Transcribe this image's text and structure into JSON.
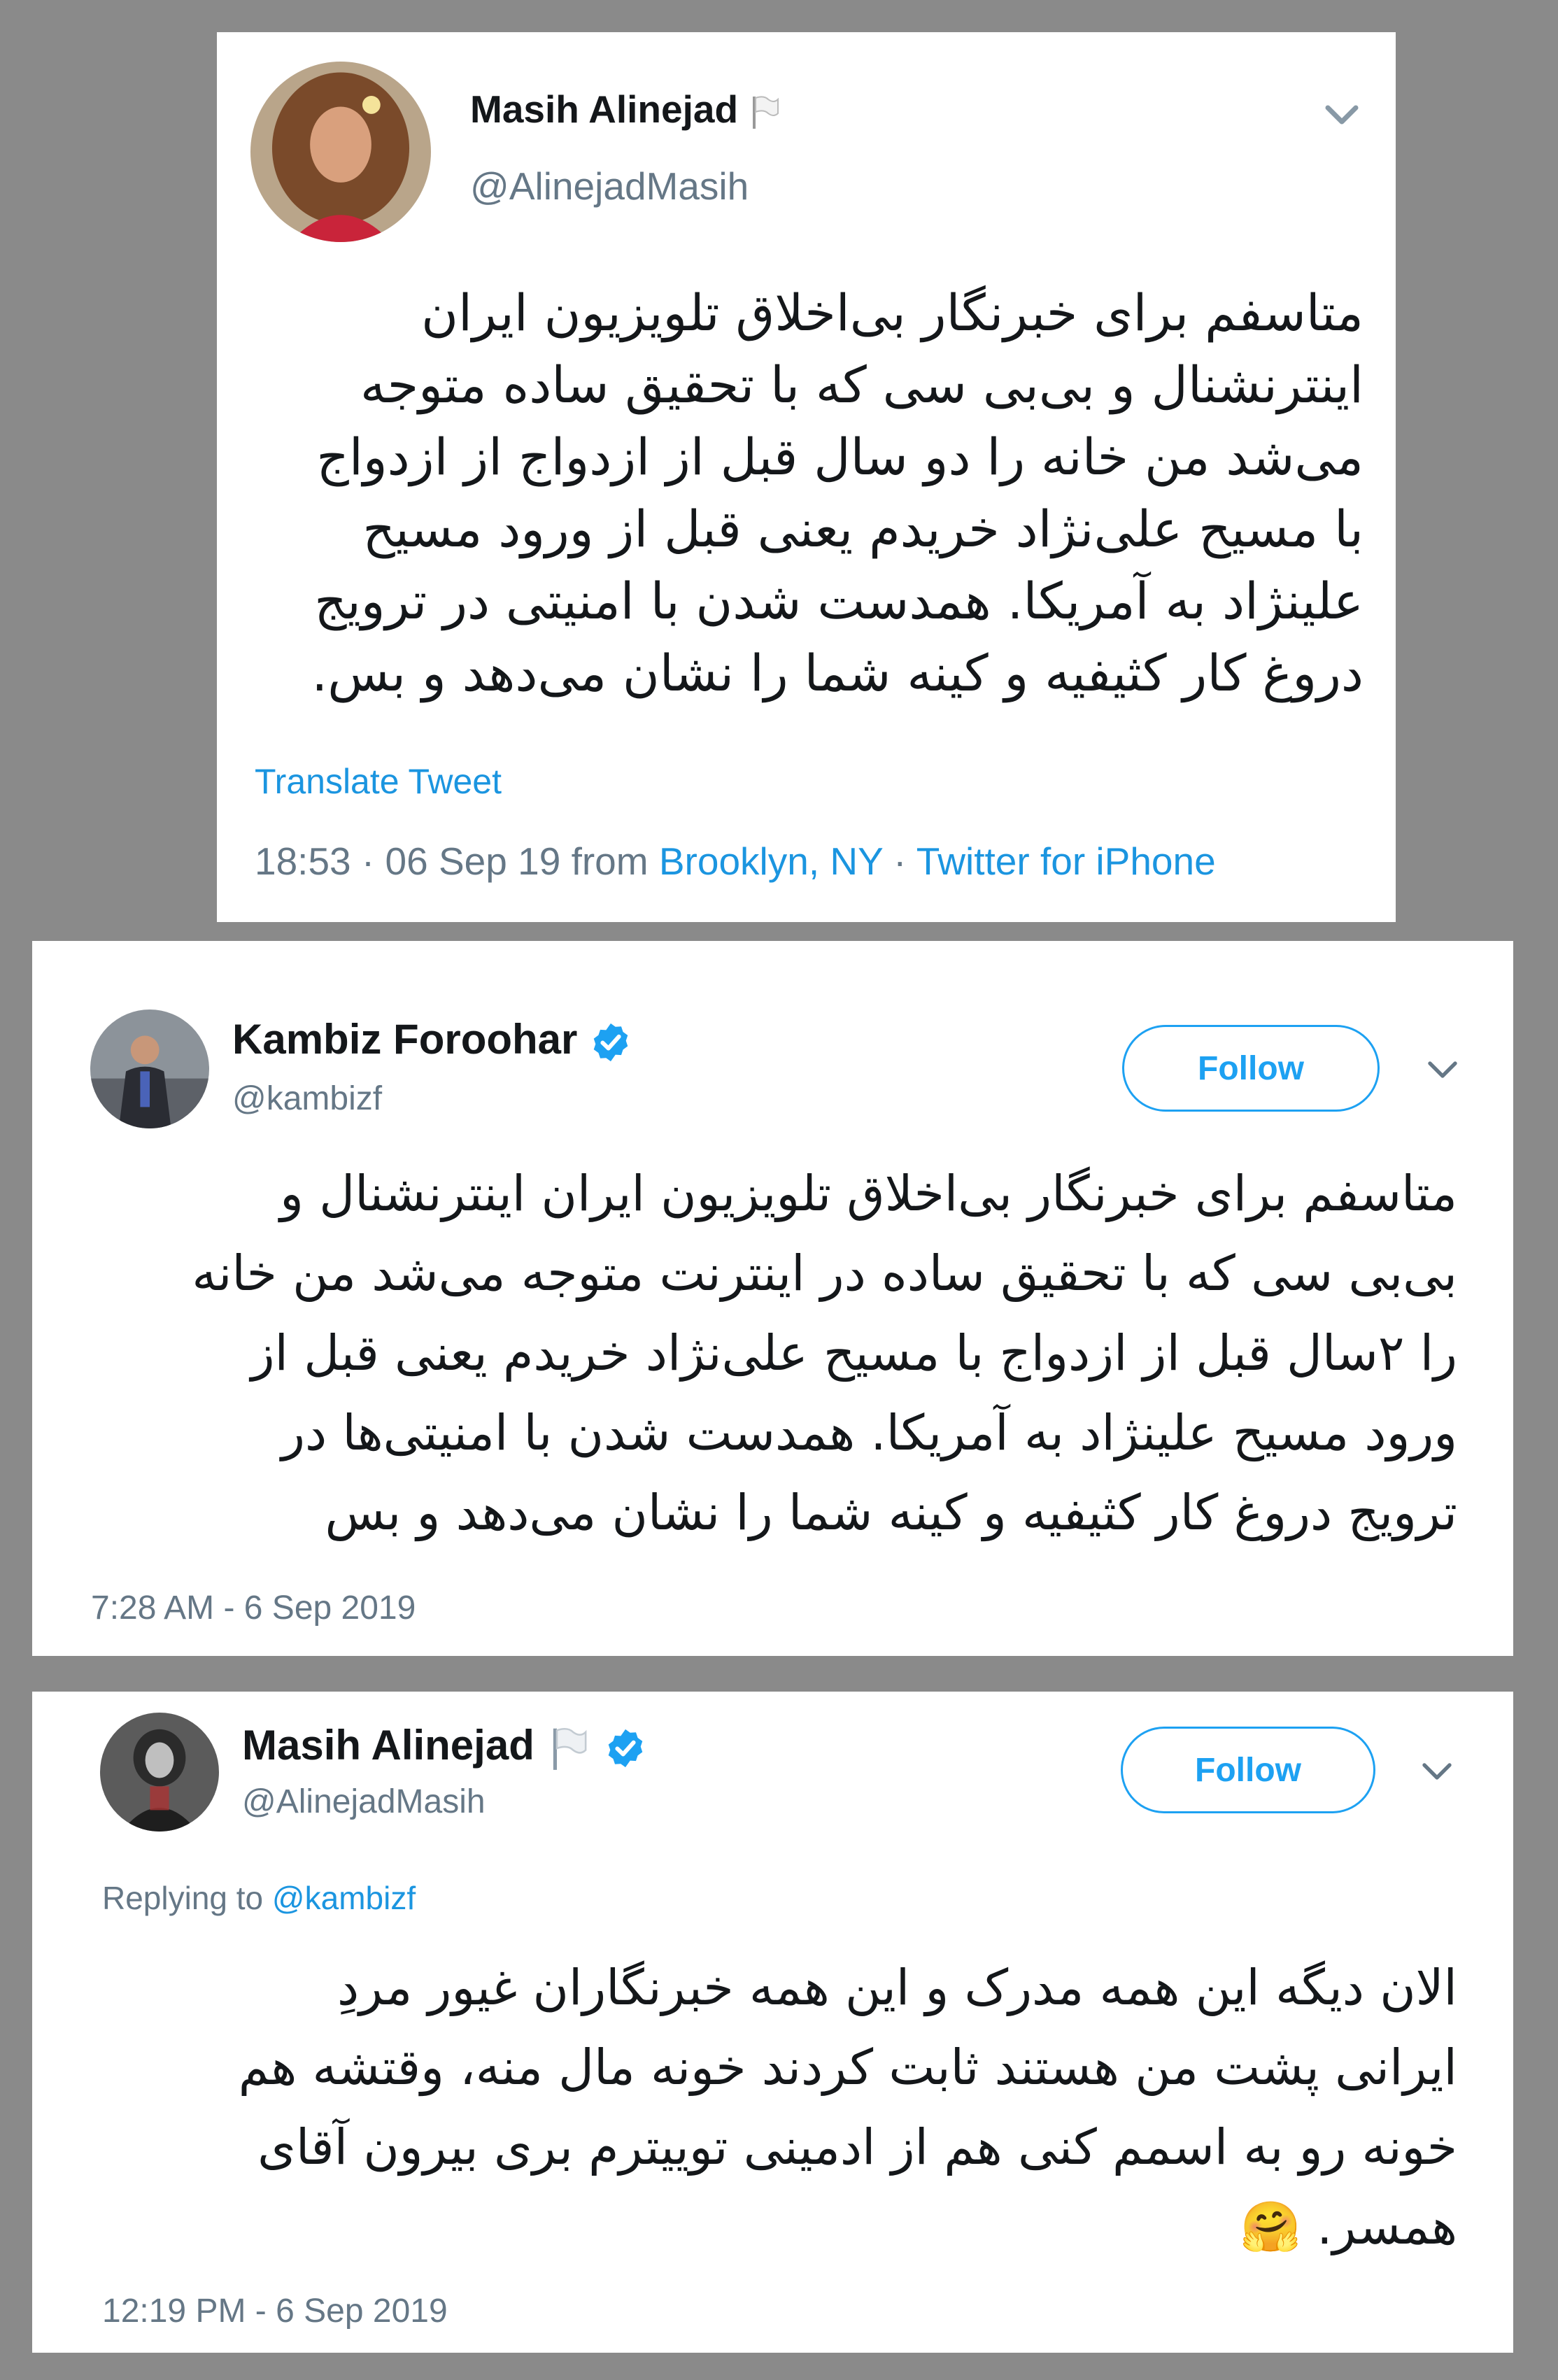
{
  "colors": {
    "background": "#8a8a8a",
    "card": "#ffffff",
    "accent": "#1da1f2",
    "link": "#1b95e0",
    "muted": "#657786",
    "text": "#14171a"
  },
  "tweet1": {
    "name": "Masih Alinejad",
    "handle": "@AlinejadMasih",
    "lines": [
      "متاسفم برای خبرنگار بی‌اخلاق تلویزیون ایران",
      "اینترنشنال و بی‌بی سی که با تحقیق ساده متوجه",
      "می‌شد من خانه را دو سال قبل از ازدواج از ازدواج",
      "با مسیح علی‌نژاد خریدم یعنی قبل از ورود مسیح",
      "علینژاد به آمریکا. همدست شدن با امنیتی در ترویج",
      "دروغ کار کثیفیه و کینه شما را نشان می‌دهد و بس."
    ],
    "translate": "Translate Tweet",
    "time": "18:53 · 06 Sep 19 from ",
    "location": "Brooklyn, NY",
    "sep": " · ",
    "client": "Twitter for iPhone",
    "icons": [
      "white-flag-icon",
      "chevron-down-icon"
    ]
  },
  "tweet2": {
    "name": "Kambiz Foroohar",
    "handle": "@kambizf",
    "follow": "Follow",
    "lines": [
      "متاسفم برای خبرنگار بی‌اخلاق تلویزیون ایران اینترنشنال و",
      "بی‌بی سی که با تحقیق ساده در اینترنت متوجه می‌شد من خانه",
      "را ۲سال قبل از ازدواج با مسیح علی‌نژاد خریدم یعنی قبل از",
      "ورود مسیح علینژاد به آمریکا. همدست شدن با امنیتی‌ها در",
      "ترویج دروغ کار کثیفیه و کینه شما را نشان می‌دهد و بس"
    ],
    "time": "7:28 AM - 6 Sep 2019",
    "icons": [
      "verified-badge-icon",
      "chevron-down-icon"
    ]
  },
  "tweet3": {
    "name": "Masih Alinejad",
    "handle": "@AlinejadMasih",
    "follow": "Follow",
    "replying_prefix": "Replying to ",
    "replying_handle": "@kambizf",
    "lines": [
      "الان دیگه این همه مدرک و این همه خبرنگاران غیور مردِ",
      "ایرانی پشت من هستند ثابت کردند خونه مال منه،  وقتشه هم",
      "خونه رو به اسمم کنی هم از ادمینی توییترم بری بیرون آقای",
      "همسر. 🤗"
    ],
    "time": "12:19 PM - 6 Sep 2019",
    "icons": [
      "white-flag-icon",
      "verified-badge-icon",
      "chevron-down-icon",
      "hugging-face-emoji-icon"
    ]
  }
}
